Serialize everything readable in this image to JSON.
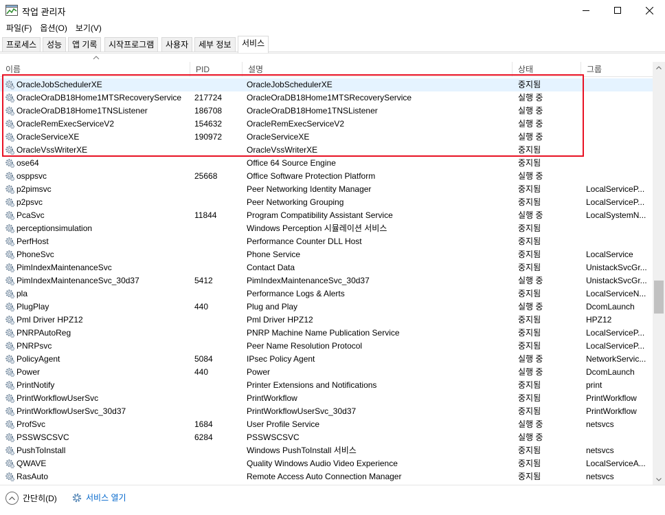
{
  "window": {
    "title": "작업 관리자",
    "minimize_icon": "minimize-icon",
    "maximize_icon": "maximize-icon",
    "close_icon": "close-icon"
  },
  "menu": [
    "파일(F)",
    "옵션(O)",
    "보기(V)"
  ],
  "tabs": [
    {
      "label": "프로세스",
      "active": false
    },
    {
      "label": "성능",
      "active": false
    },
    {
      "label": "앱 기록",
      "active": false
    },
    {
      "label": "시작프로그램",
      "active": false
    },
    {
      "label": "사용자",
      "active": false
    },
    {
      "label": "세부 정보",
      "active": false
    },
    {
      "label": "서비스",
      "active": true
    }
  ],
  "columns": {
    "name": "이름",
    "pid": "PID",
    "description": "설명",
    "status": "상태",
    "group": "그룹"
  },
  "services": [
    {
      "name": "OracleJobSchedulerXE",
      "pid": "",
      "description": "OracleJobSchedulerXE",
      "status": "중지됨",
      "group": "",
      "selected": true
    },
    {
      "name": "OracleOraDB18Home1MTSRecoveryService",
      "pid": "217724",
      "description": "OracleOraDB18Home1MTSRecoveryService",
      "status": "실행 중",
      "group": ""
    },
    {
      "name": "OracleOraDB18Home1TNSListener",
      "pid": "186708",
      "description": "OracleOraDB18Home1TNSListener",
      "status": "실행 중",
      "group": ""
    },
    {
      "name": "OracleRemExecServiceV2",
      "pid": "154632",
      "description": "OracleRemExecServiceV2",
      "status": "실행 중",
      "group": ""
    },
    {
      "name": "OracleServiceXE",
      "pid": "190972",
      "description": "OracleServiceXE",
      "status": "실행 중",
      "group": ""
    },
    {
      "name": "OracleVssWriterXE",
      "pid": "",
      "description": "OracleVssWriterXE",
      "status": "중지됨",
      "group": ""
    },
    {
      "name": "ose64",
      "pid": "",
      "description": "Office 64 Source Engine",
      "status": "중지됨",
      "group": ""
    },
    {
      "name": "osppsvc",
      "pid": "25668",
      "description": "Office Software Protection Platform",
      "status": "실행 중",
      "group": ""
    },
    {
      "name": "p2pimsvc",
      "pid": "",
      "description": "Peer Networking Identity Manager",
      "status": "중지됨",
      "group": "LocalServiceP..."
    },
    {
      "name": "p2psvc",
      "pid": "",
      "description": "Peer Networking Grouping",
      "status": "중지됨",
      "group": "LocalServiceP..."
    },
    {
      "name": "PcaSvc",
      "pid": "11844",
      "description": "Program Compatibility Assistant Service",
      "status": "실행 중",
      "group": "LocalSystemN..."
    },
    {
      "name": "perceptionsimulation",
      "pid": "",
      "description": "Windows Perception 시뮬레이션 서비스",
      "status": "중지됨",
      "group": ""
    },
    {
      "name": "PerfHost",
      "pid": "",
      "description": "Performance Counter DLL Host",
      "status": "중지됨",
      "group": ""
    },
    {
      "name": "PhoneSvc",
      "pid": "",
      "description": "Phone Service",
      "status": "중지됨",
      "group": "LocalService"
    },
    {
      "name": "PimIndexMaintenanceSvc",
      "pid": "",
      "description": "Contact Data",
      "status": "중지됨",
      "group": "UnistackSvcGr..."
    },
    {
      "name": "PimIndexMaintenanceSvc_30d37",
      "pid": "5412",
      "description": "PimIndexMaintenanceSvc_30d37",
      "status": "실행 중",
      "group": "UnistackSvcGr..."
    },
    {
      "name": "pla",
      "pid": "",
      "description": "Performance Logs & Alerts",
      "status": "중지됨",
      "group": "LocalServiceN..."
    },
    {
      "name": "PlugPlay",
      "pid": "440",
      "description": "Plug and Play",
      "status": "실행 중",
      "group": "DcomLaunch"
    },
    {
      "name": "Pml Driver HPZ12",
      "pid": "",
      "description": "Pml Driver HPZ12",
      "status": "중지됨",
      "group": "HPZ12"
    },
    {
      "name": "PNRPAutoReg",
      "pid": "",
      "description": "PNRP Machine Name Publication Service",
      "status": "중지됨",
      "group": "LocalServiceP..."
    },
    {
      "name": "PNRPsvc",
      "pid": "",
      "description": "Peer Name Resolution Protocol",
      "status": "중지됨",
      "group": "LocalServiceP..."
    },
    {
      "name": "PolicyAgent",
      "pid": "5084",
      "description": "IPsec Policy Agent",
      "status": "실행 중",
      "group": "NetworkServic..."
    },
    {
      "name": "Power",
      "pid": "440",
      "description": "Power",
      "status": "실행 중",
      "group": "DcomLaunch"
    },
    {
      "name": "PrintNotify",
      "pid": "",
      "description": "Printer Extensions and Notifications",
      "status": "중지됨",
      "group": "print"
    },
    {
      "name": "PrintWorkflowUserSvc",
      "pid": "",
      "description": "PrintWorkflow",
      "status": "중지됨",
      "group": "PrintWorkflow"
    },
    {
      "name": "PrintWorkflowUserSvc_30d37",
      "pid": "",
      "description": "PrintWorkflowUserSvc_30d37",
      "status": "중지됨",
      "group": "PrintWorkflow"
    },
    {
      "name": "ProfSvc",
      "pid": "1684",
      "description": "User Profile Service",
      "status": "실행 중",
      "group": "netsvcs"
    },
    {
      "name": "PSSWSCSVC",
      "pid": "6284",
      "description": "PSSWSCSVC",
      "status": "실행 중",
      "group": ""
    },
    {
      "name": "PushToInstall",
      "pid": "",
      "description": "Windows PushToInstall 서비스",
      "status": "중지됨",
      "group": "netsvcs"
    },
    {
      "name": "QWAVE",
      "pid": "",
      "description": "Quality Windows Audio Video Experience",
      "status": "중지됨",
      "group": "LocalServiceA..."
    },
    {
      "name": "RasAuto",
      "pid": "",
      "description": "Remote Access Auto Connection Manager",
      "status": "중지됨",
      "group": "netsvcs"
    }
  ],
  "footer": {
    "collapse_label": "간단히(D)",
    "open_services_label": "서비스 열기"
  },
  "colors": {
    "highlight": "#e81123",
    "selected_row": "#e5f3ff",
    "link": "#0066cc"
  }
}
